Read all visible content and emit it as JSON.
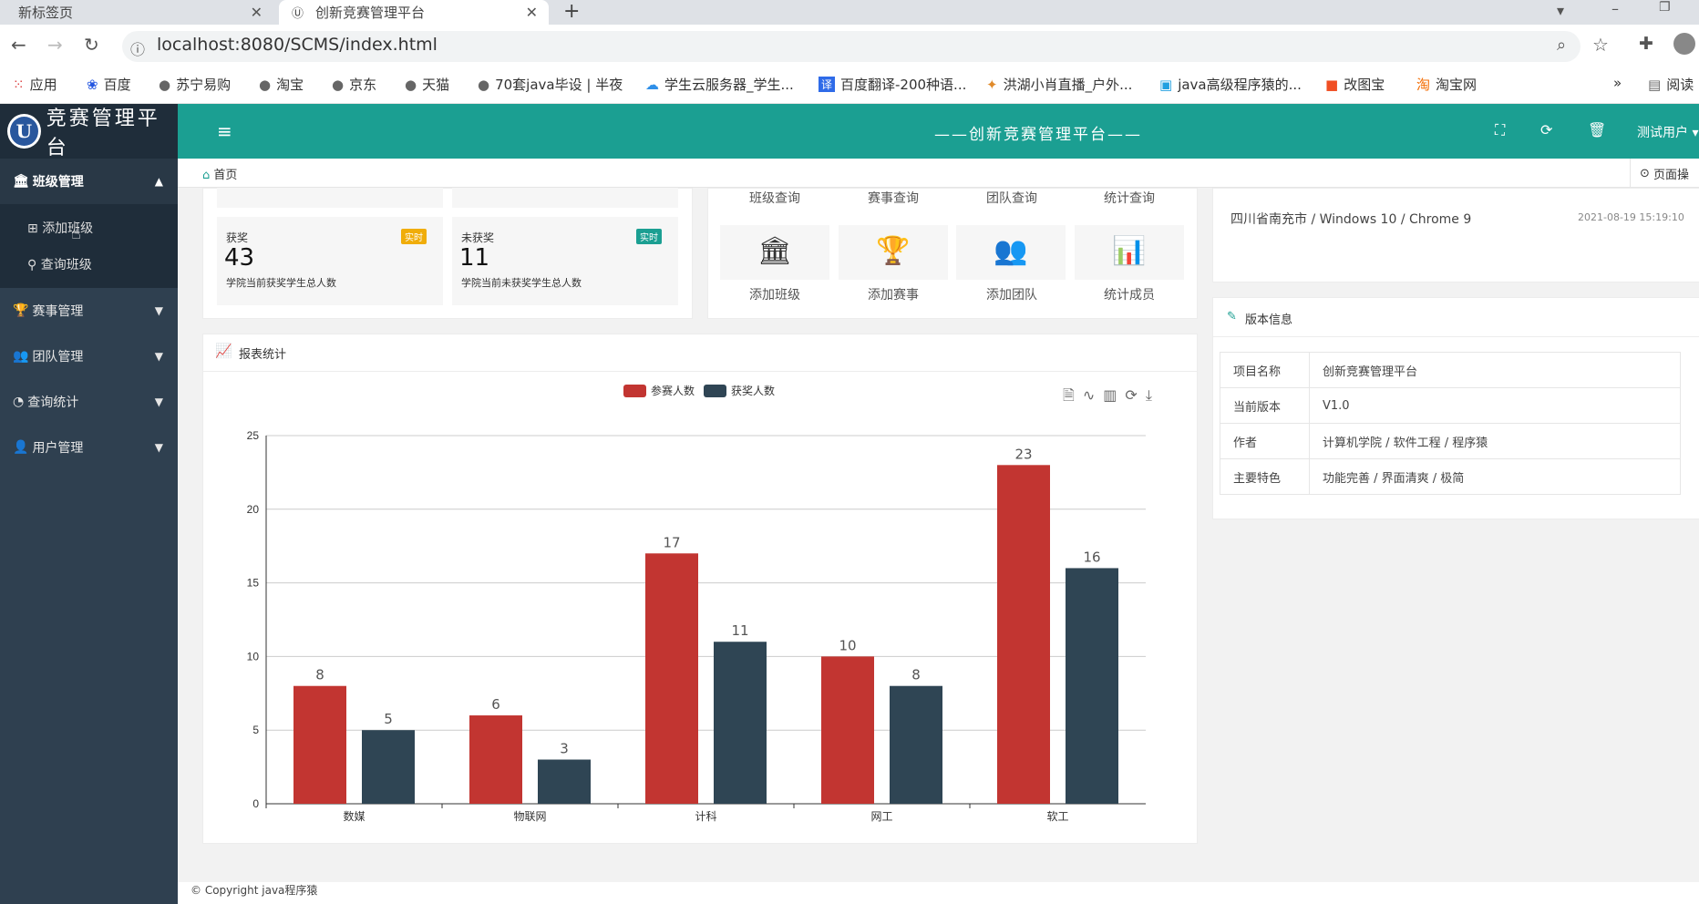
{
  "browser": {
    "tabs": [
      {
        "label": "新标签页"
      },
      {
        "label": "创新竞赛管理平台"
      }
    ],
    "url": "localhost:8080/SCMS/index.html",
    "bookmarks": [
      "应用",
      "百度",
      "苏宁易购",
      "淘宝",
      "京东",
      "天猫",
      "70套java毕设 | 半夜",
      "学生云服务器_学生...",
      "百度翻译-200种语...",
      "洪湖小肖直播_户外...",
      "java高级程序猿的...",
      "改图宝",
      "淘宝网"
    ],
    "reading_list": "阅读"
  },
  "app": {
    "logo_text": "竞赛管理平台",
    "header_title": "——创新竞赛管理平台——",
    "user": "测试用户",
    "breadcrumb_home": "首页",
    "page_ops": "页面操",
    "accent": "#1b9f92"
  },
  "sidebar": {
    "items": [
      {
        "label": "班级管理",
        "sub": [
          "添加班级",
          "查询班级"
        ]
      },
      {
        "label": "赛事管理"
      },
      {
        "label": "团队管理"
      },
      {
        "label": "查询统计"
      },
      {
        "label": "用户管理"
      }
    ]
  },
  "stats": [
    {
      "label": "获奖",
      "tag": "实时",
      "value": "43",
      "desc": "学院当前获奖学生总人数"
    },
    {
      "label": "未获奖",
      "tag": "实时",
      "value": "11",
      "desc": "学院当前未获奖学生总人数"
    }
  ],
  "quick": {
    "top_links": [
      "班级查询",
      "赛事查询",
      "团队查询",
      "统计查询"
    ],
    "bottom_links": [
      "添加班级",
      "添加赛事",
      "添加团队",
      "统计成员"
    ]
  },
  "login_info": {
    "location": "四川省南充市 / Windows 10 / Chrome 9",
    "time": "2021-08-19 15:19:10"
  },
  "version": {
    "title": "版本信息",
    "rows": [
      {
        "k": "项目名称",
        "v": "创新竞赛管理平台"
      },
      {
        "k": "当前版本",
        "v": "V1.0"
      },
      {
        "k": "作者",
        "v": "计算机学院 / 软件工程 / 程序猿"
      },
      {
        "k": "主要特色",
        "v": "功能完善 / 界面清爽 / 极简"
      }
    ]
  },
  "report": {
    "title": "报表统计"
  },
  "footer": "© Copyright java程序猿",
  "chart_data": {
    "type": "bar",
    "categories": [
      "数媒",
      "物联网",
      "计科",
      "网工",
      "软工"
    ],
    "series": [
      {
        "name": "参赛人数",
        "color": "#c23531",
        "values": [
          8,
          6,
          17,
          10,
          23
        ]
      },
      {
        "name": "获奖人数",
        "color": "#2f4554",
        "values": [
          5,
          3,
          11,
          8,
          16
        ]
      }
    ],
    "ylim": [
      0,
      25
    ],
    "yticks": [
      0,
      5,
      10,
      15,
      20,
      25
    ],
    "grid": true,
    "legend": "top-center"
  }
}
